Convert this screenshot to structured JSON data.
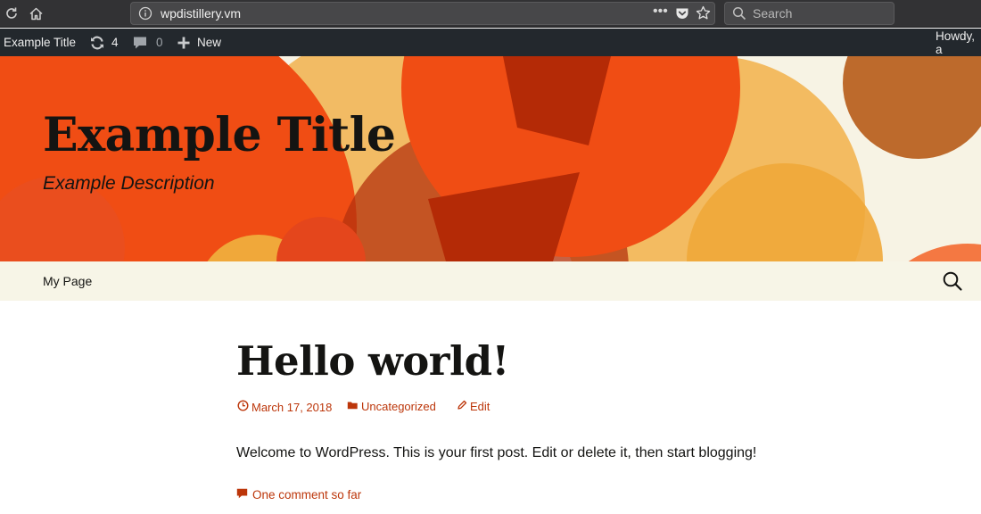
{
  "browser": {
    "url": "wpdistillery.vm",
    "search_placeholder": "Search",
    "more_label": "•••"
  },
  "adminbar": {
    "site_name": "Example Title",
    "updates_count": "4",
    "comments_count": "0",
    "new_label": "New",
    "greeting": "Howdy, a"
  },
  "header": {
    "site_title": "Example Title",
    "site_description": "Example Description"
  },
  "nav": {
    "items": [
      {
        "label": "My Page"
      }
    ]
  },
  "post": {
    "title": "Hello world!",
    "date": "March 17, 2018",
    "category": "Uncategorized",
    "edit_label": "Edit",
    "content": "Welcome to WordPress. This is your first post. Edit or delete it, then start blogging!",
    "comments_link": "One comment so far"
  },
  "colors": {
    "accent": "#bc360a",
    "admin_bar": "#23282d",
    "nav_bg": "#f7f5e7",
    "header_bg": "#f7f3e4"
  }
}
